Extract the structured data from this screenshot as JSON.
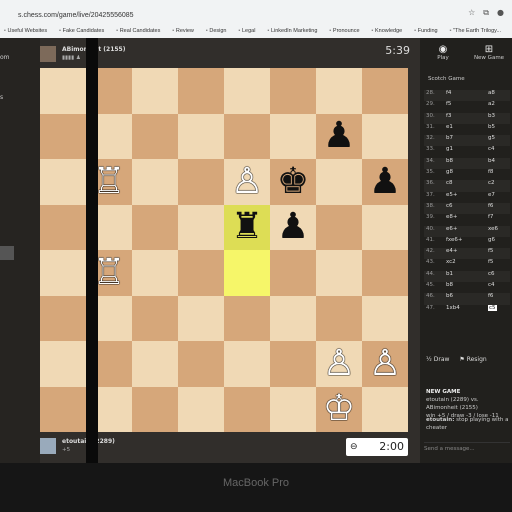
{
  "browser": {
    "url": "s.chess.com/game/live/20425556085",
    "bookmarks": [
      "Useful Websites",
      "Fake Candidates",
      "Real Candidates",
      "Review",
      "Design",
      "Legal",
      "LinkedIn Marketing",
      "Pronounce",
      "Knowledge",
      "Funding",
      "\"The Earth Trilogy..."
    ]
  },
  "leftnav": {
    "items": [
      "om",
      "s"
    ]
  },
  "top_player": {
    "name": "ABimonheit",
    "rating": "(2155)",
    "clock": "5:39"
  },
  "bottom_player": {
    "name": "etoutain",
    "rating": "(2289)",
    "material": "+5",
    "clock": "2:00"
  },
  "board": [
    [
      "",
      "",
      "",
      "",
      "",
      "",
      "",
      ""
    ],
    [
      "",
      "",
      "",
      "",
      "",
      "",
      "♟",
      ""
    ],
    [
      "",
      "♖",
      "",
      "",
      "♙",
      "♚",
      "",
      "♟"
    ],
    [
      "",
      "",
      "",
      "",
      "♜",
      "♟",
      "",
      ""
    ],
    [
      "",
      "♖",
      "",
      "",
      "",
      "",
      "",
      ""
    ],
    [
      "",
      "",
      "",
      "",
      "",
      "",
      "",
      ""
    ],
    [
      "",
      "",
      "",
      "",
      "",
      "",
      "♙",
      "♙"
    ],
    [
      "",
      "",
      "",
      "",
      "",
      "",
      "♔",
      ""
    ]
  ],
  "sidebar": {
    "tab_play": "Play",
    "tab_new_game": "New Game",
    "opening": "Scotch Game",
    "moves": [
      {
        "n": "28.",
        "w": "f4",
        "b": "a8"
      },
      {
        "n": "29.",
        "w": "f5",
        "b": "a2"
      },
      {
        "n": "30.",
        "w": "f3",
        "b": "b3"
      },
      {
        "n": "31.",
        "w": "e1",
        "b": "b5"
      },
      {
        "n": "32.",
        "w": "b7",
        "b": "g5"
      },
      {
        "n": "33.",
        "w": "g1",
        "b": "c4"
      },
      {
        "n": "34.",
        "w": "b8",
        "b": "b4"
      },
      {
        "n": "35.",
        "w": "g8",
        "b": "f8"
      },
      {
        "n": "36.",
        "w": "c8",
        "b": "c2"
      },
      {
        "n": "37.",
        "w": "e5+",
        "b": "e7"
      },
      {
        "n": "38.",
        "w": "c6",
        "b": "f6"
      },
      {
        "n": "39.",
        "w": "e8+",
        "b": "f7"
      },
      {
        "n": "40.",
        "w": "e6+",
        "b": "xe6"
      },
      {
        "n": "41.",
        "w": "fxe6+",
        "b": "g6"
      },
      {
        "n": "42.",
        "w": "e4+",
        "b": "f5"
      },
      {
        "n": "43.",
        "w": "xc2",
        "b": "f5"
      },
      {
        "n": "44.",
        "w": "b1",
        "b": "c6"
      },
      {
        "n": "45.",
        "w": "b8",
        "b": "c4"
      },
      {
        "n": "46.",
        "w": "b6",
        "b": "f6"
      },
      {
        "n": "47.",
        "w": "1xb4",
        "b": "c5"
      }
    ],
    "draw": "Draw",
    "resign": "Resign",
    "new_game_title": "NEW GAME",
    "new_game_text": "etoutain (2289) vs. ABimonheit (2155)",
    "record": "win +5 / draw -3 / lose -11",
    "chat_user": "etoutain:",
    "chat_text": "stop playing with a",
    "chat_text2": "cheater",
    "send_placeholder": "Send a message..."
  },
  "device_label": "MacBook Pro"
}
